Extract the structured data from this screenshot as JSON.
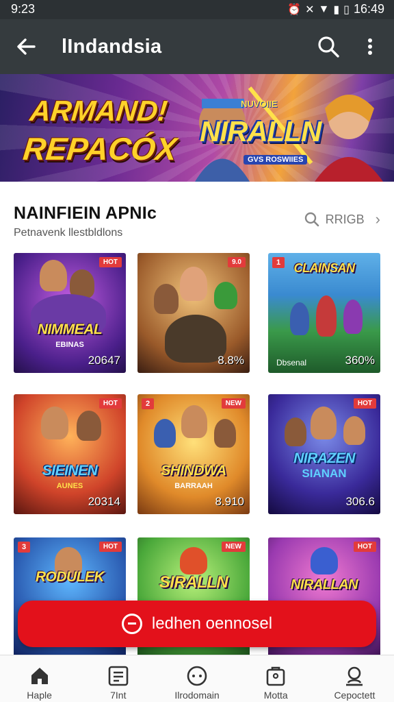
{
  "status_bar": {
    "time": "9:23",
    "right_time": "16:49"
  },
  "app_bar": {
    "title": "lIndandsia"
  },
  "banner": {
    "line1": "ARMAND!",
    "line2": "REPACÓX",
    "logo_top": "NUVOIIE",
    "logo": "NIRALLN",
    "logo_sub": "GVS ROSWIIES"
  },
  "section": {
    "title": "NAINFIEIN APNIc",
    "subtitle": "Petnavenk llestbldlons",
    "action_label": "RRIGB"
  },
  "tiles": [
    {
      "badge": "HOT",
      "title": "NIMMEAL",
      "subtitle": "EBINAS",
      "label": "",
      "number": "20647"
    },
    {
      "badge": "9.0",
      "title": "",
      "subtitle": "",
      "label": "",
      "number": "8.8%"
    },
    {
      "badge_left": "1",
      "title": "CLAINSAN",
      "subtitle": "",
      "label": "Dbsenal",
      "number": "360%"
    },
    {
      "badge": "HOT",
      "title": "SIEINEN",
      "subtitle": "AUNES",
      "label": "",
      "number": "20314"
    },
    {
      "badge_left": "2",
      "badge": "NEW",
      "title": "SHINDWA",
      "subtitle": "BARRAAH",
      "label": "",
      "number": "8.910"
    },
    {
      "badge": "HOT",
      "title": "NIRAZEN",
      "subtitle": "SIANAN",
      "label": "",
      "number": "306.6"
    },
    {
      "badge_left": "3",
      "badge": "HOT",
      "title": "RODULEK",
      "subtitle": "",
      "label": "",
      "number": ""
    },
    {
      "badge": "NEW",
      "title": "SIRALLN",
      "subtitle": "",
      "label": "",
      "number": ""
    },
    {
      "badge": "HOT",
      "title": "NIRALLAN",
      "subtitle": "",
      "label": "",
      "number": ""
    }
  ],
  "fab": {
    "label": "ledhen oennosel"
  },
  "bottom_nav": [
    {
      "label": "Haple",
      "icon": "home-icon"
    },
    {
      "label": "7Int",
      "icon": "list-icon"
    },
    {
      "label": "Ilrodomain",
      "icon": "compass-icon"
    },
    {
      "label": "Motta",
      "icon": "bag-icon"
    },
    {
      "label": "Cepoctett",
      "icon": "profile-icon"
    }
  ],
  "colors": {
    "accent": "#e3111b",
    "app_bar": "#353b3e",
    "status_bar": "#2c3134"
  }
}
